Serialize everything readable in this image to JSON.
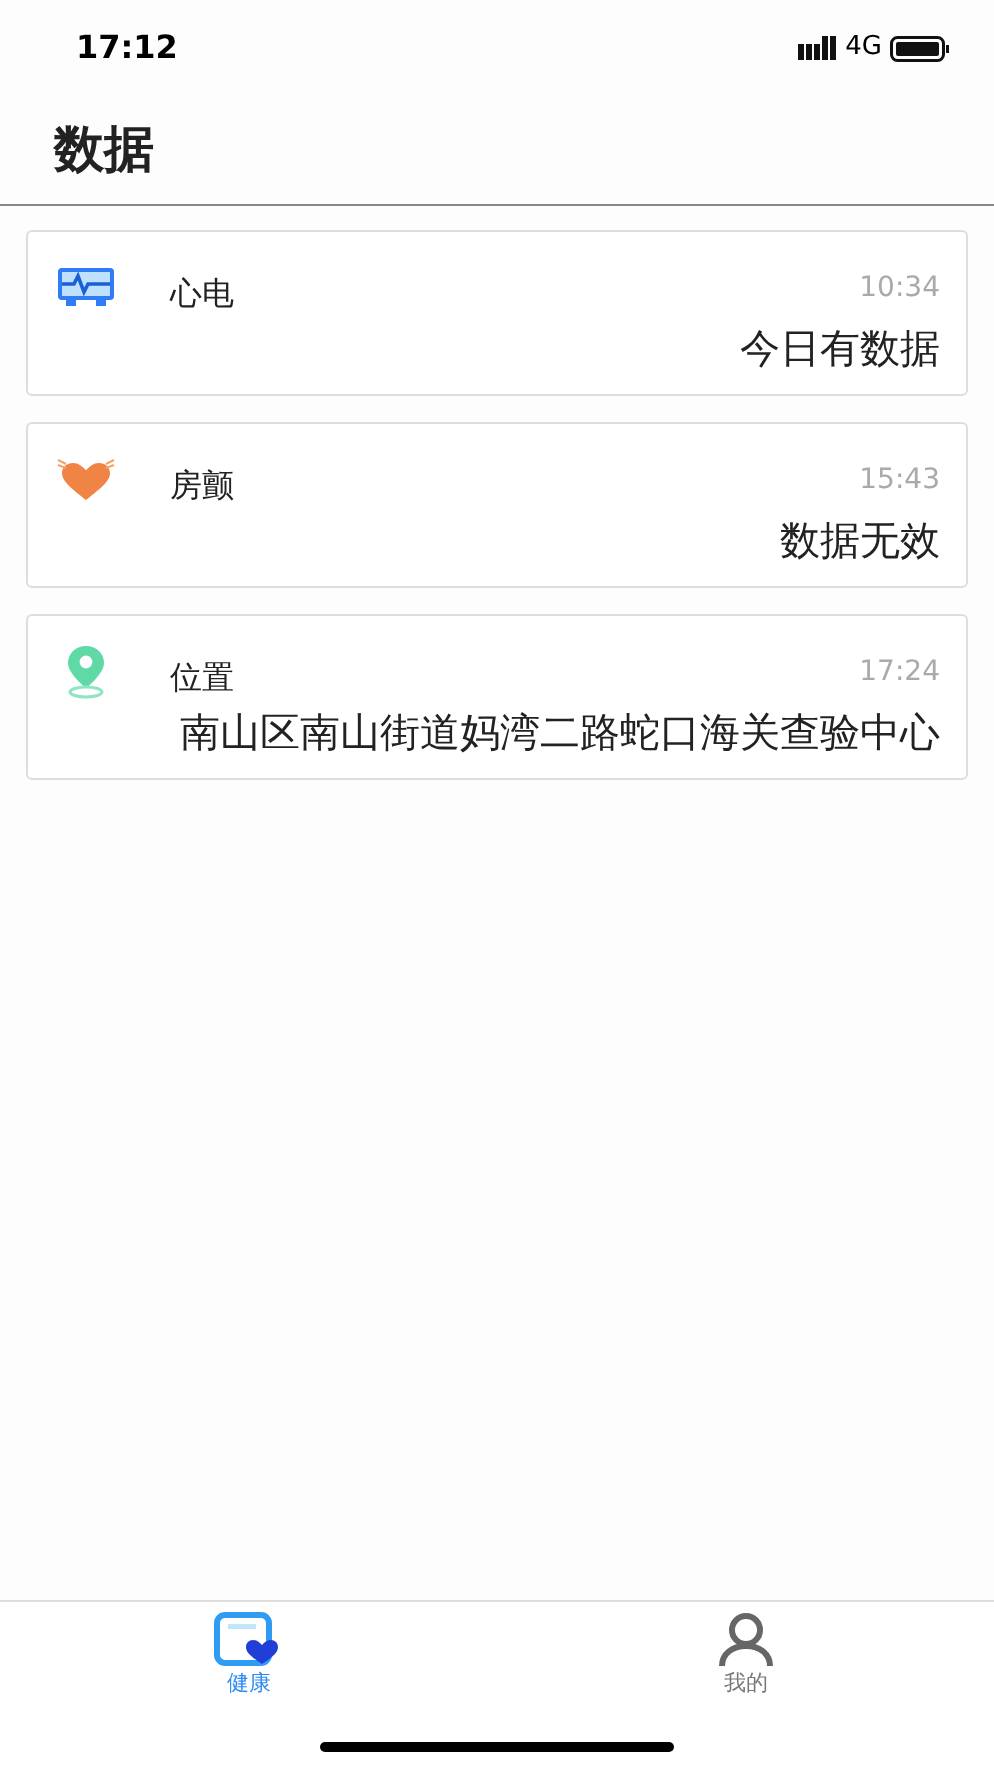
{
  "status_bar": {
    "time": "17:12",
    "network": "4G"
  },
  "header": {
    "title": "数据"
  },
  "cards": [
    {
      "kind": "ecg",
      "title": "心电",
      "time": "10:34",
      "value": "今日有数据"
    },
    {
      "kind": "breast",
      "title": "房颤",
      "time": "15:43",
      "value": "数据无效"
    },
    {
      "kind": "location",
      "title": "位置",
      "time": "17:24",
      "value": "南山区南山街道妈湾二路蛇口海关查验中心"
    }
  ],
  "tab_bar": [
    {
      "kind": "health",
      "label": "健康",
      "selected": true
    },
    {
      "kind": "profile",
      "label": "我的",
      "selected": false
    }
  ]
}
